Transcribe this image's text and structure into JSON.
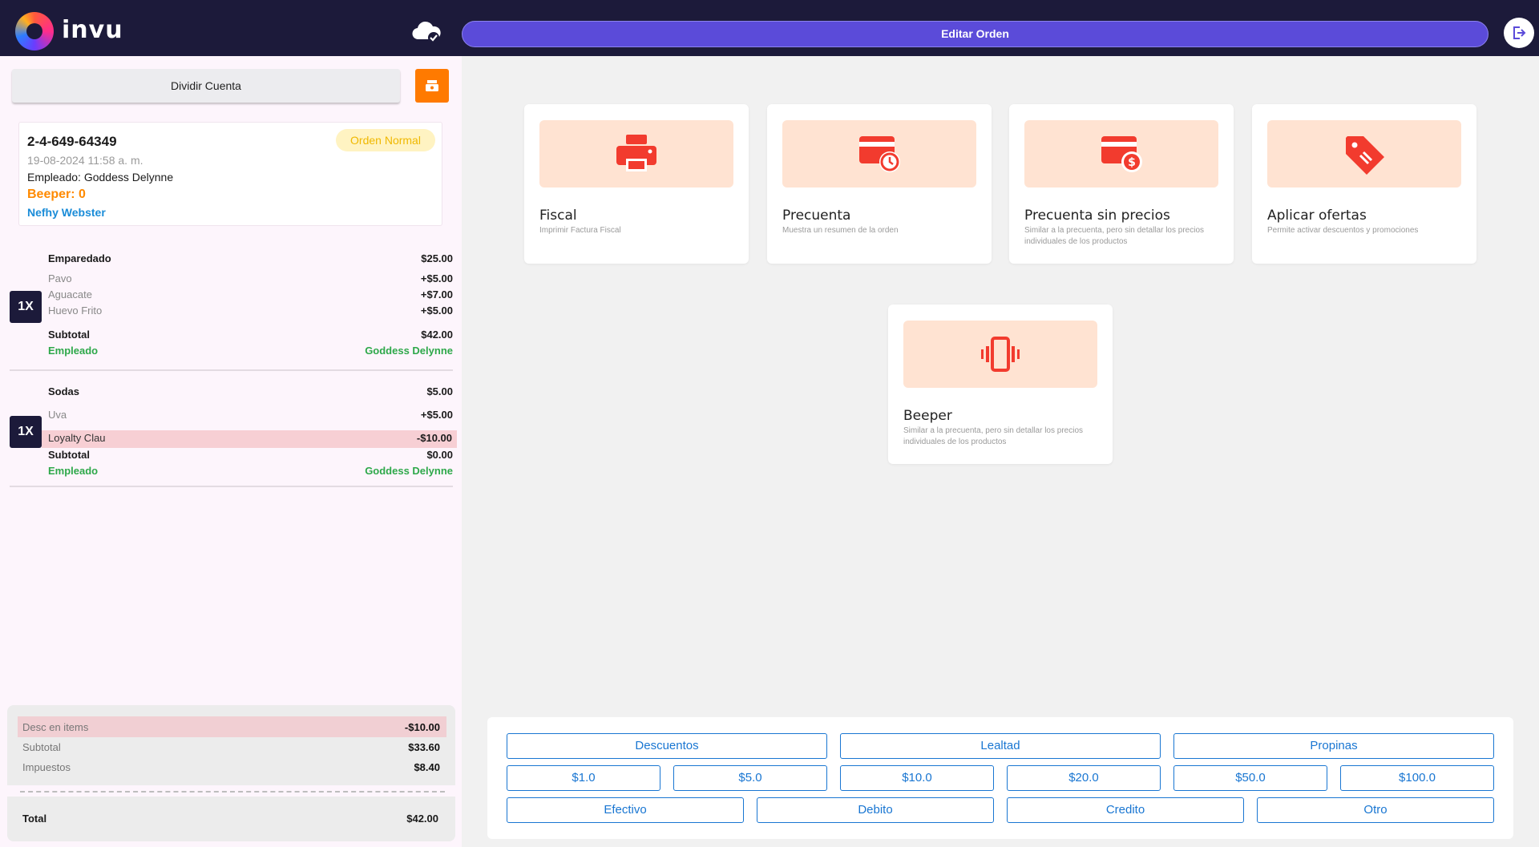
{
  "header": {
    "logo_text": "invu",
    "edit_button": "Editar Orden",
    "cloud_icon": "cloud-check-icon",
    "logout_icon": "logout-icon"
  },
  "left": {
    "split_button": "Dividir Cuenta",
    "cash_drawer_icon": "cash-drawer-icon",
    "order": {
      "id": "2-4-649-64349",
      "badge": "Orden Normal",
      "date": "19-08-2024 11:58 a. m.",
      "employee_label": "Empleado:",
      "employee_name": "Goddess Delynne",
      "beeper": "Beeper: 0",
      "customer": "Nefhy Webster"
    },
    "items": [
      {
        "qty": "1X",
        "name": "Emparedado",
        "price": "$25.00",
        "modifiers": [
          {
            "name": "Pavo",
            "price": "+$5.00"
          },
          {
            "name": "Aguacate",
            "price": "+$7.00"
          },
          {
            "name": "Huevo Frito",
            "price": "+$5.00"
          }
        ],
        "subtotal_label": "Subtotal",
        "subtotal": "$42.00",
        "employee_label": "Empleado",
        "employee": "Goddess Delynne"
      },
      {
        "qty": "1X",
        "name": "Sodas",
        "price": "$5.00",
        "modifiers": [
          {
            "name": "Uva",
            "price": "+$5.00"
          }
        ],
        "discount": {
          "name": "Loyalty Clau",
          "price": "-$10.00"
        },
        "subtotal_label": "Subtotal",
        "subtotal": "$0.00",
        "employee_label": "Empleado",
        "employee": "Goddess Delynne"
      }
    ],
    "totals": {
      "discount_label": "Desc en items",
      "discount": "-$10.00",
      "subtotal_label": "Subtotal",
      "subtotal": "$33.60",
      "tax_label": "Impuestos",
      "tax": "$8.40",
      "total_label": "Total",
      "total": "$42.00"
    }
  },
  "actions": [
    {
      "title": "Fiscal",
      "desc": "Imprimir Factura Fiscal",
      "icon": "printer-icon"
    },
    {
      "title": "Precuenta",
      "desc": "Muestra un resumen de la orden",
      "icon": "card-clock-icon"
    },
    {
      "title": "Precuenta sin precios",
      "desc": "Similar a la precuenta, pero sin detallar los precios individuales de los productos",
      "icon": "card-dollar-icon"
    },
    {
      "title": "Aplicar ofertas",
      "desc": "Permite activar descuentos y promociones",
      "icon": "tag-icon"
    },
    {
      "title": "Beeper",
      "desc": "Similar a la precuenta, pero sin detallar los precios individuales de los productos",
      "icon": "vibrate-phone-icon"
    }
  ],
  "payment": {
    "row1": [
      "Descuentos",
      "Lealtad",
      "Propinas"
    ],
    "amounts": [
      "$1.0",
      "$5.0",
      "$10.0",
      "$20.0",
      "$50.0",
      "$100.0"
    ],
    "methods": [
      "Efectivo",
      "Debito",
      "Credito",
      "Otro"
    ]
  },
  "colors": {
    "topbar": "#1c1a3a",
    "accent": "#5b4bd9",
    "icon_red": "#f23b2e",
    "icon_bg": "#ffe3d2",
    "payment_blue": "#1976d2",
    "beeper_orange": "#ff8a00",
    "customer_blue": "#1a8cd8",
    "employee_green": "#2ea84a"
  }
}
